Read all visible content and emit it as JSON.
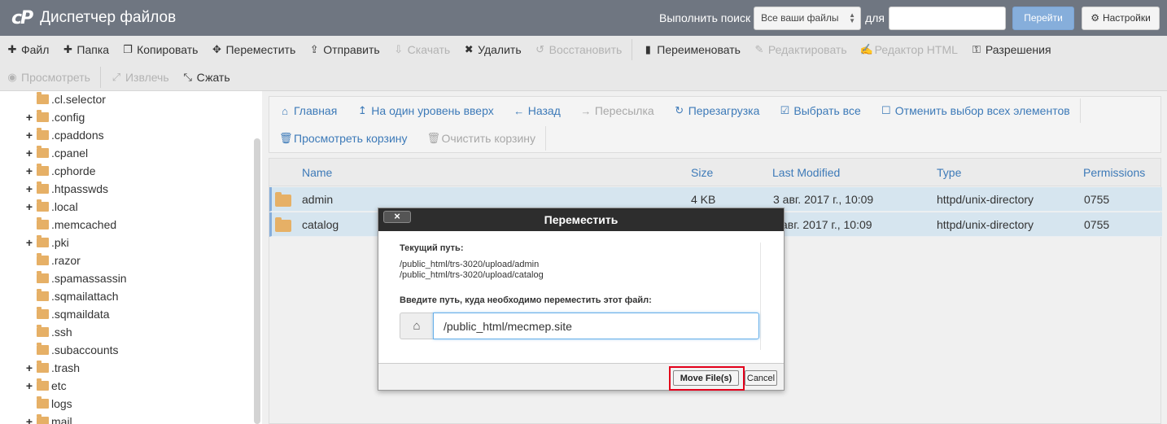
{
  "header": {
    "title": "Диспетчер файлов",
    "logo_text": "cP",
    "search_label": "Выполнить поиск",
    "search_scope": "Все ваши файлы",
    "search_for": "для",
    "search_value": "",
    "go_label": "Перейти",
    "settings_label": "Настройки"
  },
  "toolbar": {
    "row1": [
      {
        "label": "Файл",
        "icon": "plus-icon",
        "enabled": true
      },
      {
        "label": "Папка",
        "icon": "plus-icon",
        "enabled": true
      },
      {
        "label": "Копировать",
        "icon": "copy-icon",
        "enabled": true
      },
      {
        "label": "Переместить",
        "icon": "move-icon",
        "enabled": true
      },
      {
        "label": "Отправить",
        "icon": "upload-icon",
        "enabled": true
      },
      {
        "label": "Скачать",
        "icon": "download-icon",
        "enabled": false
      },
      {
        "label": "Удалить",
        "icon": "delete-icon",
        "enabled": true
      },
      {
        "label": "Восстановить",
        "icon": "undo-icon",
        "enabled": false
      },
      {
        "label": "Переименовать",
        "icon": "file-icon",
        "enabled": true
      },
      {
        "label": "Редактировать",
        "icon": "pencil-icon",
        "enabled": false
      },
      {
        "label": "Редактор HTML",
        "icon": "edit-icon",
        "enabled": false
      },
      {
        "label": "Разрешения",
        "icon": "key-icon",
        "enabled": true
      }
    ],
    "row2": [
      {
        "label": "Просмотреть",
        "icon": "eye-icon",
        "enabled": false
      },
      {
        "label": "Извлечь",
        "icon": "expand-icon",
        "enabled": false
      },
      {
        "label": "Сжать",
        "icon": "compress-icon",
        "enabled": true
      }
    ]
  },
  "sidebar": {
    "items": [
      {
        "name": ".cl.selector",
        "expandable": false
      },
      {
        "name": ".config",
        "expandable": true
      },
      {
        "name": ".cpaddons",
        "expandable": true
      },
      {
        "name": ".cpanel",
        "expandable": true
      },
      {
        "name": ".cphorde",
        "expandable": true
      },
      {
        "name": ".htpasswds",
        "expandable": true
      },
      {
        "name": ".local",
        "expandable": true
      },
      {
        "name": ".memcached",
        "expandable": false
      },
      {
        "name": ".pki",
        "expandable": true
      },
      {
        "name": ".razor",
        "expandable": false
      },
      {
        "name": ".spamassassin",
        "expandable": false
      },
      {
        "name": ".sqmailattach",
        "expandable": false
      },
      {
        "name": ".sqmaildata",
        "expandable": false
      },
      {
        "name": ".ssh",
        "expandable": false
      },
      {
        "name": ".subaccounts",
        "expandable": false
      },
      {
        "name": ".trash",
        "expandable": true
      },
      {
        "name": "etc",
        "expandable": true
      },
      {
        "name": "logs",
        "expandable": false
      },
      {
        "name": "mail",
        "expandable": true
      }
    ]
  },
  "nav": {
    "row1": [
      {
        "label": "Главная",
        "icon": "home-icon",
        "enabled": true
      },
      {
        "label": "На один уровень вверх",
        "icon": "level-up-icon",
        "enabled": true
      },
      {
        "label": "Назад",
        "icon": "arrow-left-icon",
        "enabled": true
      },
      {
        "label": "Пересылка",
        "icon": "arrow-right-icon",
        "enabled": false
      },
      {
        "label": "Перезагрузка",
        "icon": "refresh-icon",
        "enabled": true
      },
      {
        "label": "Выбрать все",
        "icon": "checkbox-checked-icon",
        "enabled": true
      },
      {
        "label": "Отменить выбор всех элементов",
        "icon": "checkbox-empty-icon",
        "enabled": true
      }
    ],
    "row2": [
      {
        "label": "Просмотреть корзину",
        "icon": "trash-icon",
        "enabled": true
      },
      {
        "label": "Очистить корзину",
        "icon": "trash-icon",
        "enabled": false
      }
    ]
  },
  "table": {
    "columns": [
      "Name",
      "Size",
      "Last Modified",
      "Type",
      "Permissions"
    ],
    "rows": [
      {
        "name": "admin",
        "size": "4 KB",
        "modified": "3 авг. 2017 г., 10:09",
        "type": "httpd/unix-directory",
        "perms": "0755"
      },
      {
        "name": "catalog",
        "size": "",
        "modified": "авг. 2017 г., 10:09",
        "type": "httpd/unix-directory",
        "perms": "0755"
      }
    ]
  },
  "modal": {
    "title": "Переместить",
    "close_label": "×",
    "current_path_label": "Текущий путь:",
    "paths": [
      "/public_html/trs-3020/upload/admin",
      "/public_html/trs-3020/upload/catalog"
    ],
    "dest_label": "Введите путь, куда необходимо переместить этот файл:",
    "dest_value": "/public_html/mecmep.site",
    "move_label": "Move File(s)",
    "cancel_label": "Cancel"
  },
  "colors": {
    "header_bg": "#6f7681",
    "link": "#3d7ab8",
    "selected_row": "#d6e5ef",
    "highlight": "#e3001b",
    "folder": "#e6b066"
  }
}
